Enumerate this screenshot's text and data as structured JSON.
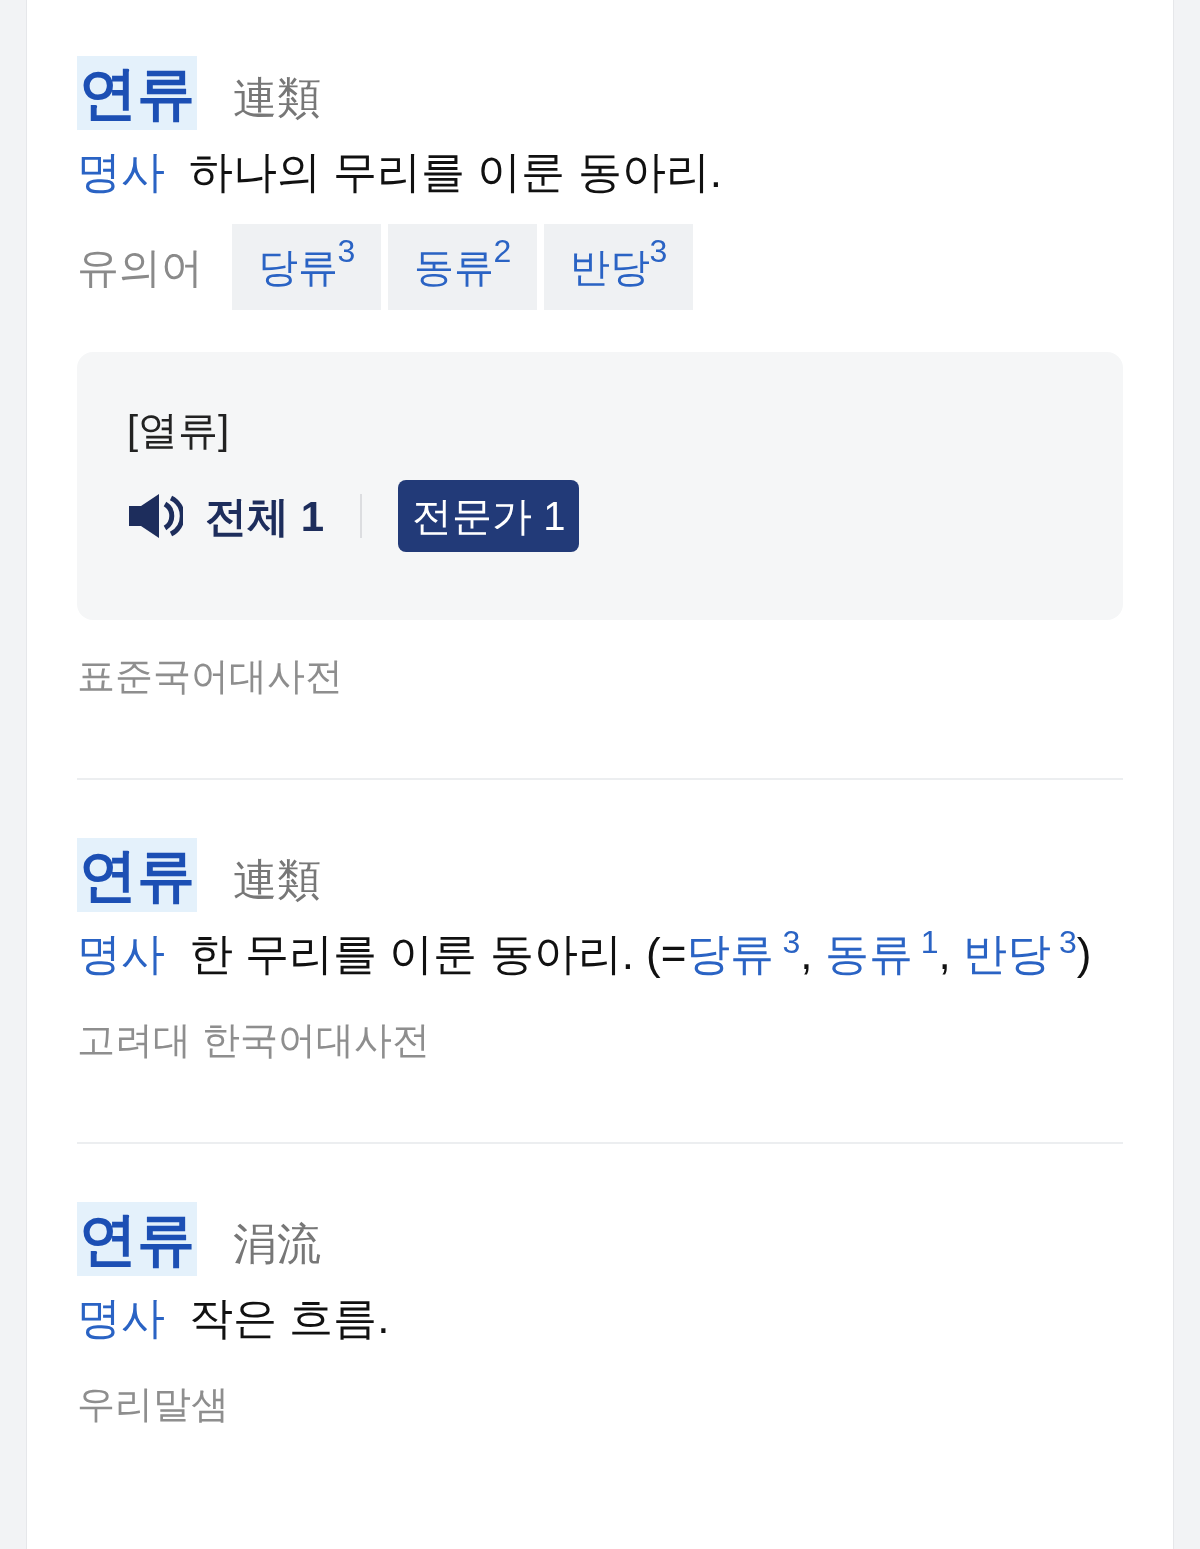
{
  "entries": [
    {
      "headword": "연류",
      "hanja": "連類",
      "pos": "명사",
      "definition": [
        {
          "kind": "text",
          "text": "하나의 무리를 이룬 동아리."
        }
      ],
      "synonyms_label": "유의어",
      "synonyms": [
        {
          "word": "당류",
          "sup": "3"
        },
        {
          "word": "동류",
          "sup": "2"
        },
        {
          "word": "반당",
          "sup": "3"
        }
      ],
      "pronunciation": {
        "text": "[열류]",
        "all": "전체 1",
        "expert": "전문가 1"
      },
      "source": "표준국어대사전"
    },
    {
      "headword": "연류",
      "hanja": "連類",
      "pos": "명사",
      "definition": [
        {
          "kind": "text",
          "text": "한 무리를 이룬 동아리. (="
        },
        {
          "kind": "link",
          "text": "당류",
          "sup": "3"
        },
        {
          "kind": "text",
          "text": ", "
        },
        {
          "kind": "link",
          "text": "동류",
          "sup": "1"
        },
        {
          "kind": "text",
          "text": ", "
        },
        {
          "kind": "link",
          "text": "반당",
          "sup": "3"
        },
        {
          "kind": "text",
          "text": ")"
        }
      ],
      "source": "고려대 한국어대사전"
    },
    {
      "headword": "연류",
      "hanja": "涓流",
      "pos": "명사",
      "definition": [
        {
          "kind": "text",
          "text": "작은 흐름."
        }
      ],
      "source": "우리말샘"
    }
  ]
}
